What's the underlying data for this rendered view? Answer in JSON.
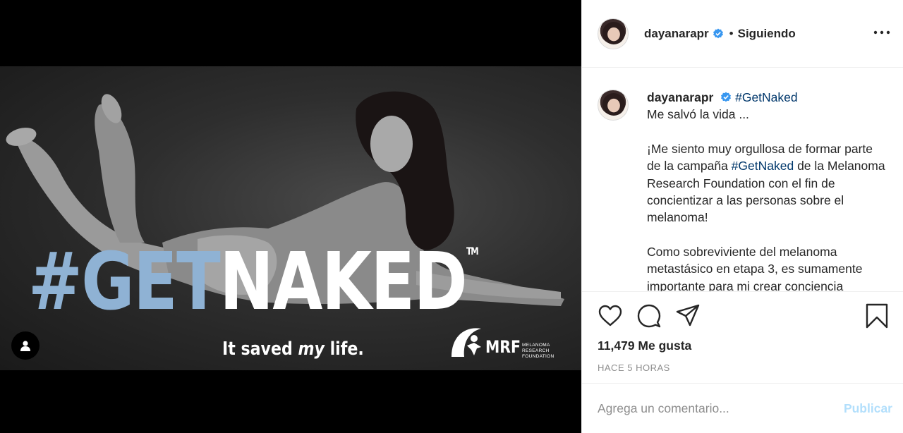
{
  "post": {
    "image": {
      "headline_hash": "#",
      "headline_get": "GET",
      "headline_naked": "NAKED",
      "headline_tm": "TM",
      "tagline_start": "It saved ",
      "tagline_em": "my",
      "tagline_end": " life.",
      "logo_text": "MRF",
      "logo_sub": [
        "MELANOMA",
        "RESEARCH",
        "FOUNDATION"
      ]
    },
    "header": {
      "username": "dayanarapr",
      "separator": "•",
      "follow_label": "Siguiendo"
    },
    "caption": {
      "username": "dayanarapr",
      "hashtag": "#GetNaked",
      "line1": "Me salvó la vida ...",
      "para2_before": "¡Me siento muy orgullosa de formar parte de la campaña ",
      "para2_hashtag": "#GetNaked",
      "para2_after": " de la Melanoma Research Foundation con el fin de concientizar a las personas sobre el melanoma!",
      "para3": "Como sobreviviente del melanoma metastásico en etapa 3, es sumamente importante para mi crear conciencia"
    },
    "actions": {
      "icons": [
        "heart-icon",
        "comment-icon",
        "share-icon",
        "bookmark-icon"
      ],
      "likes": "11,479 Me gusta",
      "timestamp": "HACE 5 HORAS"
    },
    "comment": {
      "placeholder": "Agrega un comentario...",
      "publish_label": "Publicar"
    },
    "colors": {
      "hashtag_blue": "#8fb2d4",
      "link_blue": "#00376b",
      "verified_blue": "#3897f0",
      "publish_disabled": "#b2dffc",
      "muted_text": "#8e8e8e"
    }
  }
}
